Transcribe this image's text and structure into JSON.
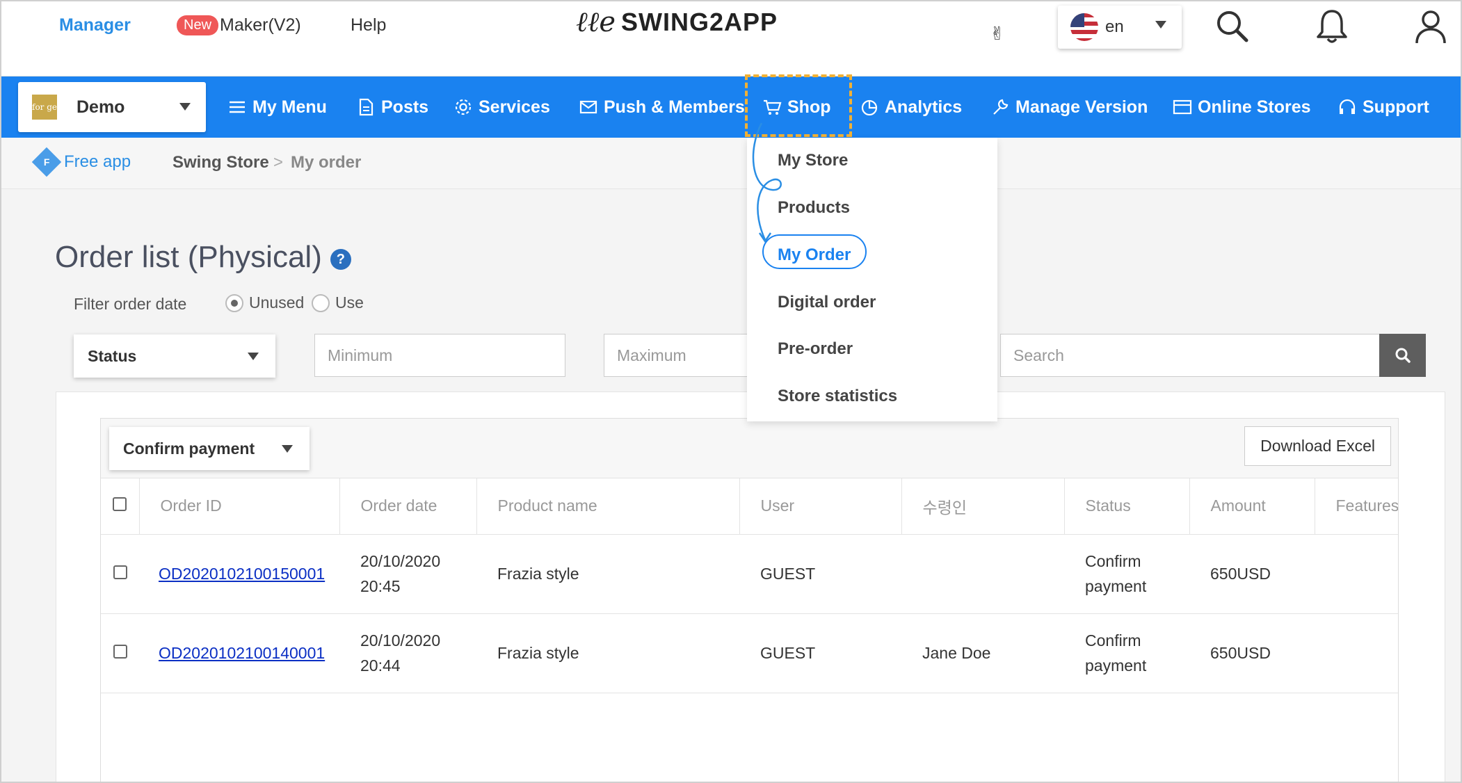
{
  "top": {
    "manager": "Manager",
    "new_badge": "New",
    "maker": "Maker(V2)",
    "help": "Help",
    "logo": "SWING2APP",
    "language": "en"
  },
  "nav": {
    "app_name": "Demo",
    "app_thumb": "for ge",
    "items": [
      "My Menu",
      "Posts",
      "Services",
      "Push & Members",
      "Shop",
      "Analytics",
      "Manage Version",
      "Online Stores",
      "Support"
    ]
  },
  "breadcrumb": {
    "badge": "Free app",
    "badge_letter": "F",
    "level1": "Swing Store",
    "separator": ">",
    "level2": "My order"
  },
  "page": {
    "title": "Order list (Physical)",
    "filter_label": "Filter order date",
    "radio_unused": "Unused",
    "radio_use": "Use",
    "status_select": "Status",
    "min_placeholder": "Minimum",
    "max_placeholder": "Maximum",
    "search_placeholder": "Search"
  },
  "table": {
    "bulk_action": "Confirm payment",
    "download": "Download Excel",
    "columns": [
      "Order ID",
      "Order date",
      "Product name",
      "User",
      "수령인",
      "Status",
      "Amount",
      "Features"
    ],
    "rows": [
      {
        "id": "OD2020102100150001",
        "date1": "20/10/2020",
        "date2": "20:45",
        "product": "Frazia style",
        "user": "GUEST",
        "recipient": "",
        "status1": "Confirm",
        "status2": "payment",
        "amount": "650USD"
      },
      {
        "id": "OD2020102100140001",
        "date1": "20/10/2020",
        "date2": "20:44",
        "product": "Frazia style",
        "user": "GUEST",
        "recipient": "Jane Doe",
        "status1": "Confirm",
        "status2": "payment",
        "amount": "650USD"
      }
    ]
  },
  "dropdown": {
    "items": [
      "My Store",
      "Products",
      "My Order",
      "Digital order",
      "Pre-order",
      "Store statistics"
    ],
    "active": "My Order"
  },
  "colors": {
    "nav_blue": "#1a82f0",
    "highlight": "#f2b134",
    "link_blue": "#0b2fc4"
  }
}
